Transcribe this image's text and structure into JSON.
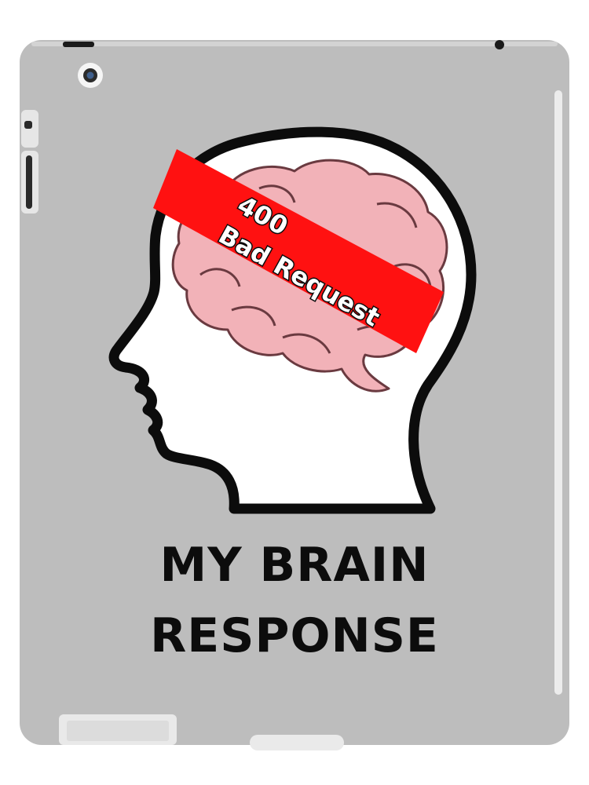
{
  "product": {
    "banner_text_line_1": "400",
    "banner_text_line_2": "Bad Request",
    "caption_line_1": "MY BRAIN",
    "caption_line_2": "RESPONSE"
  },
  "colors": {
    "case_body": "#bdbdbd",
    "banner": "#ff1111",
    "brain": "#f2b2b8",
    "outline": "#0c0c0c",
    "head_fill": "#ffffff"
  },
  "icons": {
    "camera": "camera-lens-icon",
    "speaker": "speaker-grille-icon",
    "hinge": "hinge-icon"
  }
}
